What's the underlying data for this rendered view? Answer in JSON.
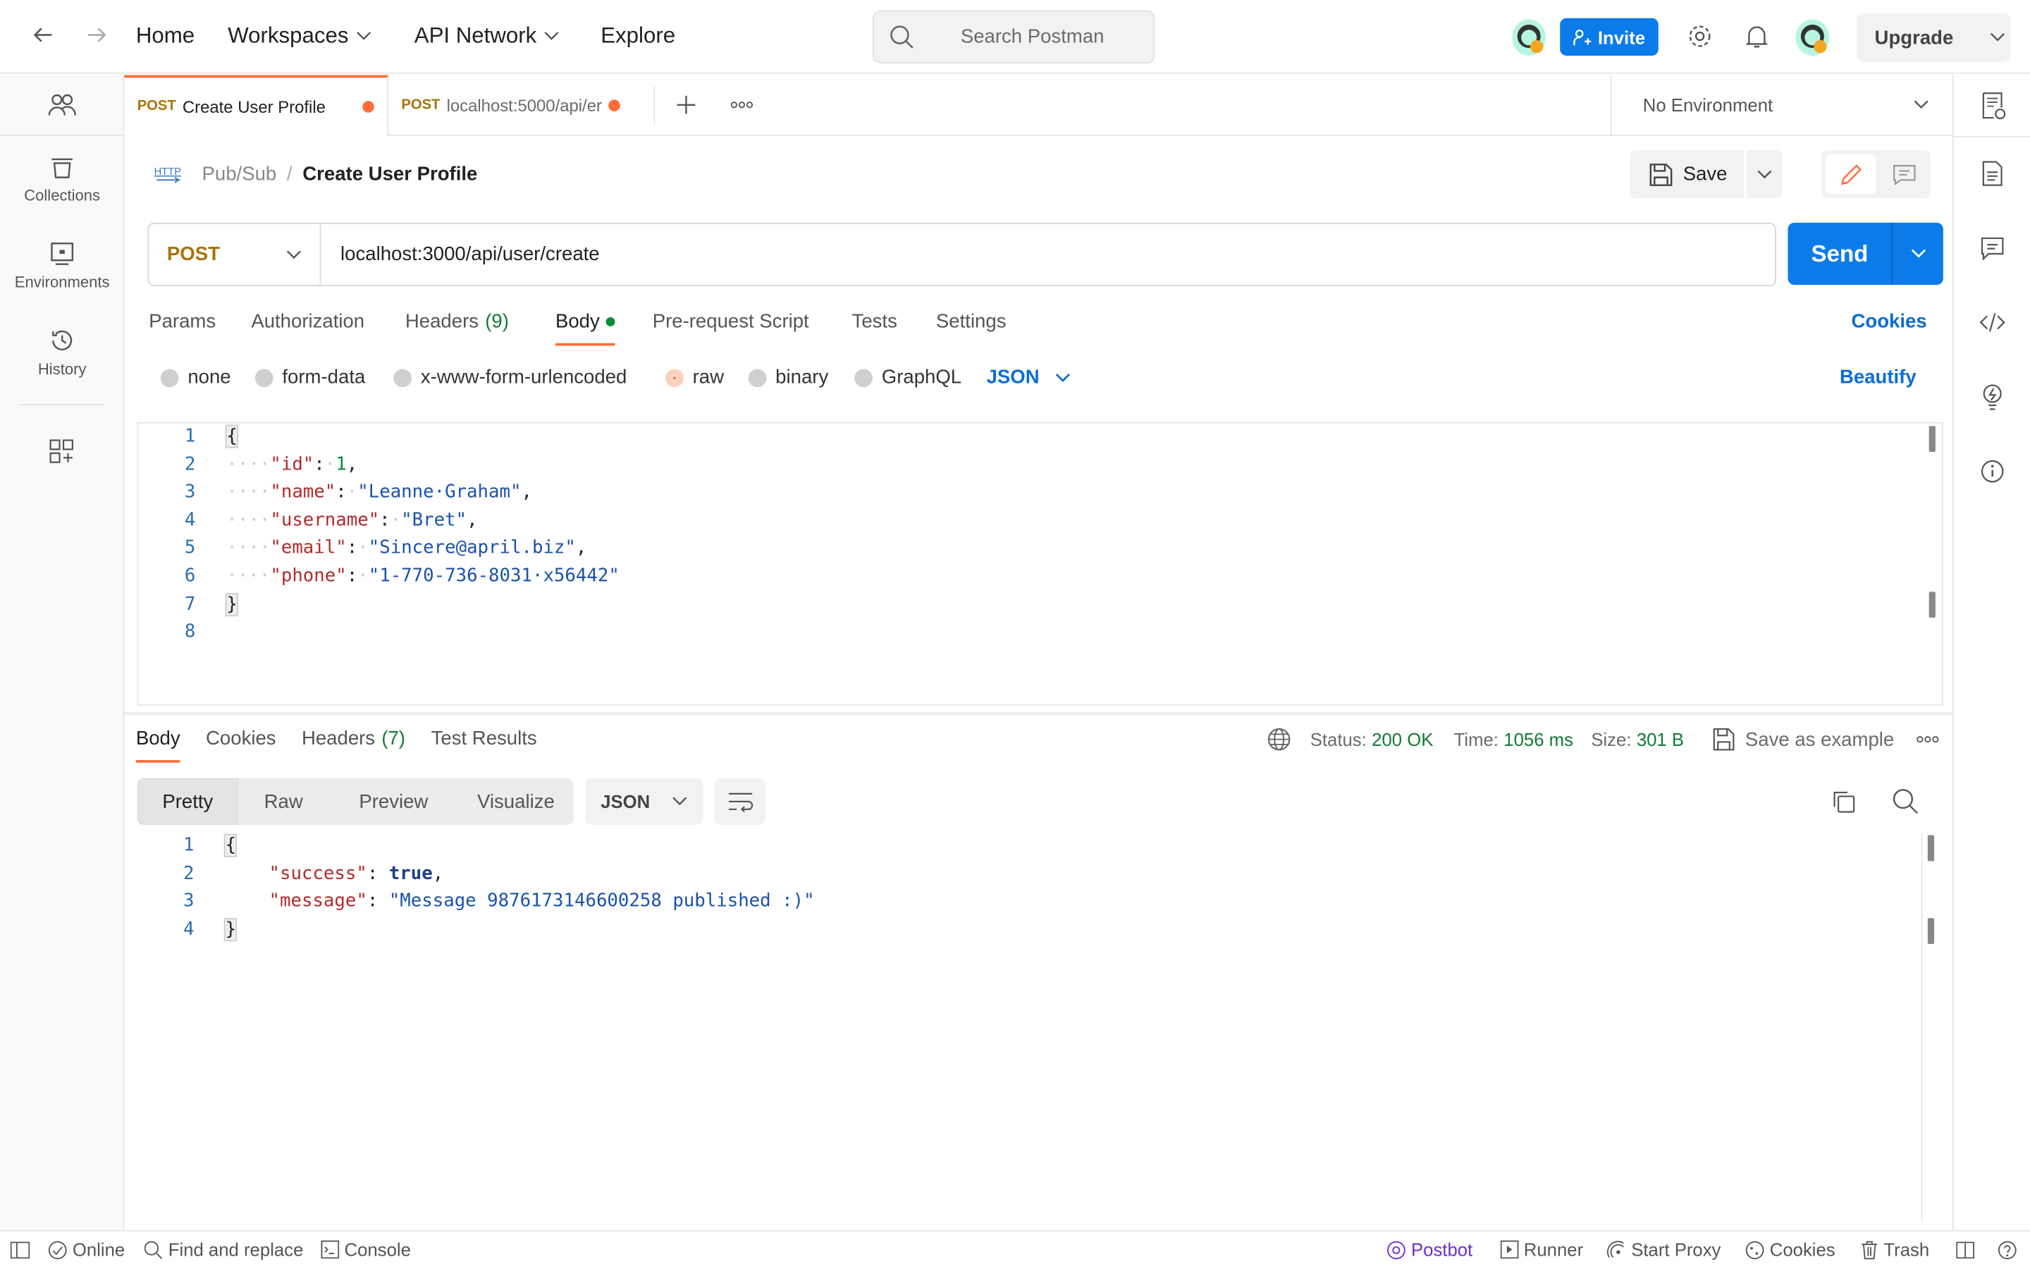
{
  "topbar": {
    "nav": [
      "Home",
      "Workspaces",
      "API Network",
      "Explore"
    ],
    "search_placeholder": "Search Postman",
    "invite": "Invite",
    "upgrade": "Upgrade"
  },
  "sidebar": {
    "items": [
      {
        "label": "Collections",
        "icon": "collections-icon"
      },
      {
        "label": "Environments",
        "icon": "environments-icon"
      },
      {
        "label": "History",
        "icon": "history-icon"
      }
    ]
  },
  "tabs": [
    {
      "method": "POST",
      "title": "Create User Profile",
      "unsaved": true,
      "active": true
    },
    {
      "method": "POST",
      "title": "localhost:5000/api/er",
      "unsaved": true,
      "active": false
    }
  ],
  "environment": "No Environment",
  "breadcrumb": {
    "parent": "Pub/Sub",
    "separator": "/",
    "current": "Create User Profile",
    "icon_text": "HTTP"
  },
  "save_label": "Save",
  "request": {
    "method": "POST",
    "url": "localhost:3000/api/user/create",
    "send": "Send"
  },
  "request_tabs": [
    {
      "label": "Params"
    },
    {
      "label": "Authorization"
    },
    {
      "label": "Headers",
      "count": "(9)"
    },
    {
      "label": "Body",
      "active": true
    },
    {
      "label": "Pre-request Script"
    },
    {
      "label": "Tests"
    },
    {
      "label": "Settings"
    }
  ],
  "cookies": "Cookies",
  "body_types": [
    "none",
    "form-data",
    "x-www-form-urlencoded",
    "raw",
    "binary",
    "GraphQL"
  ],
  "body_type_selected": "raw",
  "body_format": "JSON",
  "beautify": "Beautify",
  "request_body": [
    [
      [
        "p",
        "{"
      ]
    ],
    [
      [
        "ws",
        "····"
      ],
      [
        "k",
        "\"id\""
      ],
      [
        "p",
        ":"
      ],
      [
        "ws",
        "·"
      ],
      [
        "n",
        "1"
      ],
      [
        "p",
        ","
      ]
    ],
    [
      [
        "ws",
        "····"
      ],
      [
        "k",
        "\"name\""
      ],
      [
        "p",
        ":"
      ],
      [
        "ws",
        "·"
      ],
      [
        "s",
        "\"Leanne·Graham\""
      ],
      [
        "p",
        ","
      ]
    ],
    [
      [
        "ws",
        "····"
      ],
      [
        "k",
        "\"username\""
      ],
      [
        "p",
        ":"
      ],
      [
        "ws",
        "·"
      ],
      [
        "s",
        "\"Bret\""
      ],
      [
        "p",
        ","
      ]
    ],
    [
      [
        "ws",
        "····"
      ],
      [
        "k",
        "\"email\""
      ],
      [
        "p",
        ":"
      ],
      [
        "ws",
        "·"
      ],
      [
        "s",
        "\"Sincere@april.biz\""
      ],
      [
        "p",
        ","
      ]
    ],
    [
      [
        "ws",
        "····"
      ],
      [
        "k",
        "\"phone\""
      ],
      [
        "p",
        ":"
      ],
      [
        "ws",
        "·"
      ],
      [
        "s",
        "\"1-770-736-8031·x56442\""
      ]
    ],
    [
      [
        "p",
        "}"
      ]
    ],
    []
  ],
  "response_tabs": [
    {
      "label": "Body",
      "active": true
    },
    {
      "label": "Cookies"
    },
    {
      "label": "Headers",
      "count": "(7)"
    },
    {
      "label": "Test Results"
    }
  ],
  "response_meta": {
    "status_label": "Status:",
    "status": "200 OK",
    "time_label": "Time:",
    "time": "1056 ms",
    "size_label": "Size:",
    "size": "301 B",
    "save_example": "Save as example"
  },
  "view_modes": [
    "Pretty",
    "Raw",
    "Preview",
    "Visualize"
  ],
  "response_format": "JSON",
  "response_body": [
    [
      [
        "p",
        "{"
      ]
    ],
    [
      [
        "p",
        "    "
      ],
      [
        "k",
        "\"success\""
      ],
      [
        "p",
        ": "
      ],
      [
        "b",
        "true"
      ],
      [
        "p",
        ","
      ]
    ],
    [
      [
        "p",
        "    "
      ],
      [
        "k",
        "\"message\""
      ],
      [
        "p",
        ": "
      ],
      [
        "s",
        "\"Message 9876173146600258 published :)\""
      ]
    ],
    [
      [
        "p",
        "}"
      ]
    ]
  ],
  "footer": {
    "left": [
      "Online",
      "Find and replace",
      "Console"
    ],
    "right": [
      "Postbot",
      "Runner",
      "Start Proxy",
      "Cookies",
      "Trash"
    ]
  },
  "colors": {
    "accent": "#ff6c37",
    "primary": "#0c7bea",
    "success": "#137a33",
    "postbot": "#6b2fd0"
  }
}
